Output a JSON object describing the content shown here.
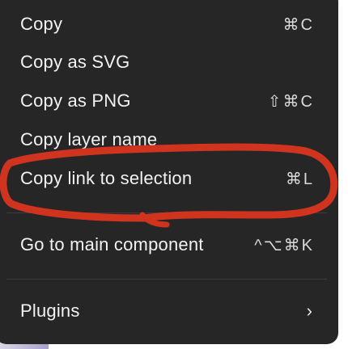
{
  "menu": {
    "items": [
      {
        "label": "Copy",
        "shortcut": "⌘C"
      },
      {
        "label": "Copy as SVG",
        "shortcut": ""
      },
      {
        "label": "Copy as PNG",
        "shortcut": "⇧⌘C"
      },
      {
        "label": "Copy layer name",
        "shortcut": ""
      },
      {
        "label": "Copy link to selection",
        "shortcut": "⌘L"
      },
      {
        "label": "Go to main component",
        "shortcut": "^⌥⌘K"
      },
      {
        "label": "Plugins",
        "submenu_indicator": "›"
      }
    ]
  },
  "annotation": {
    "color": "#d0341f",
    "highlighted_item": "Copy link to selection"
  },
  "colors": {
    "menu_background": "#262626",
    "text": "#f2f2f2",
    "divider": "#3d3d3d"
  }
}
